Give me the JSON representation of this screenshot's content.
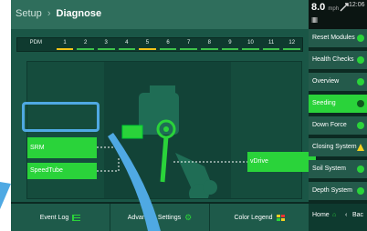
{
  "breadcrumb": {
    "parent": "Setup",
    "separator": "›",
    "current": "Diagnose"
  },
  "status": {
    "speed": "8.0",
    "speed_unit": "mph",
    "time": "12:06",
    "signal": "IIIII"
  },
  "row_table": {
    "header": "PDM",
    "rows": [
      "1",
      "2",
      "3",
      "4",
      "5",
      "6",
      "7",
      "8",
      "9",
      "10",
      "11",
      "12"
    ],
    "indicator_colors": [
      "#f2c318",
      "#3ec24a",
      "#3ec24a",
      "#3ec24a",
      "#f2c318",
      "#3ec24a",
      "#3ec24a",
      "#3ec24a",
      "#3ec24a",
      "#3ec24a",
      "#3ec24a",
      "#3ec24a"
    ]
  },
  "diagram": {
    "left_modules": [
      "SRM",
      "SpeedTube"
    ],
    "right_modules": [
      "vDrive"
    ]
  },
  "bottom_bar": {
    "event_log": "Event Log",
    "advanced": "Advanced Settings",
    "color_legend": "Color Legend"
  },
  "sidebar": {
    "items": [
      {
        "label": "Reset Modules",
        "icon": "refresh-icon"
      },
      {
        "label": "Health Checks",
        "icon": "health-icon"
      },
      {
        "label": "Overview",
        "icon": "status-ok-icon"
      },
      {
        "label": "Seeding",
        "icon": "status-ok-icon"
      },
      {
        "label": "Down Force",
        "icon": "status-ok-icon"
      },
      {
        "label": "Closing System",
        "icon": "warning-icon"
      },
      {
        "label": "Soil System",
        "icon": "status-ok-icon"
      },
      {
        "label": "Depth System",
        "icon": "status-ok-icon"
      }
    ],
    "home": "Home",
    "back": "Bac"
  },
  "colors": {
    "accent": "#2ad33a",
    "warning": "#f2d020",
    "highlight": "#4fa9e3"
  }
}
